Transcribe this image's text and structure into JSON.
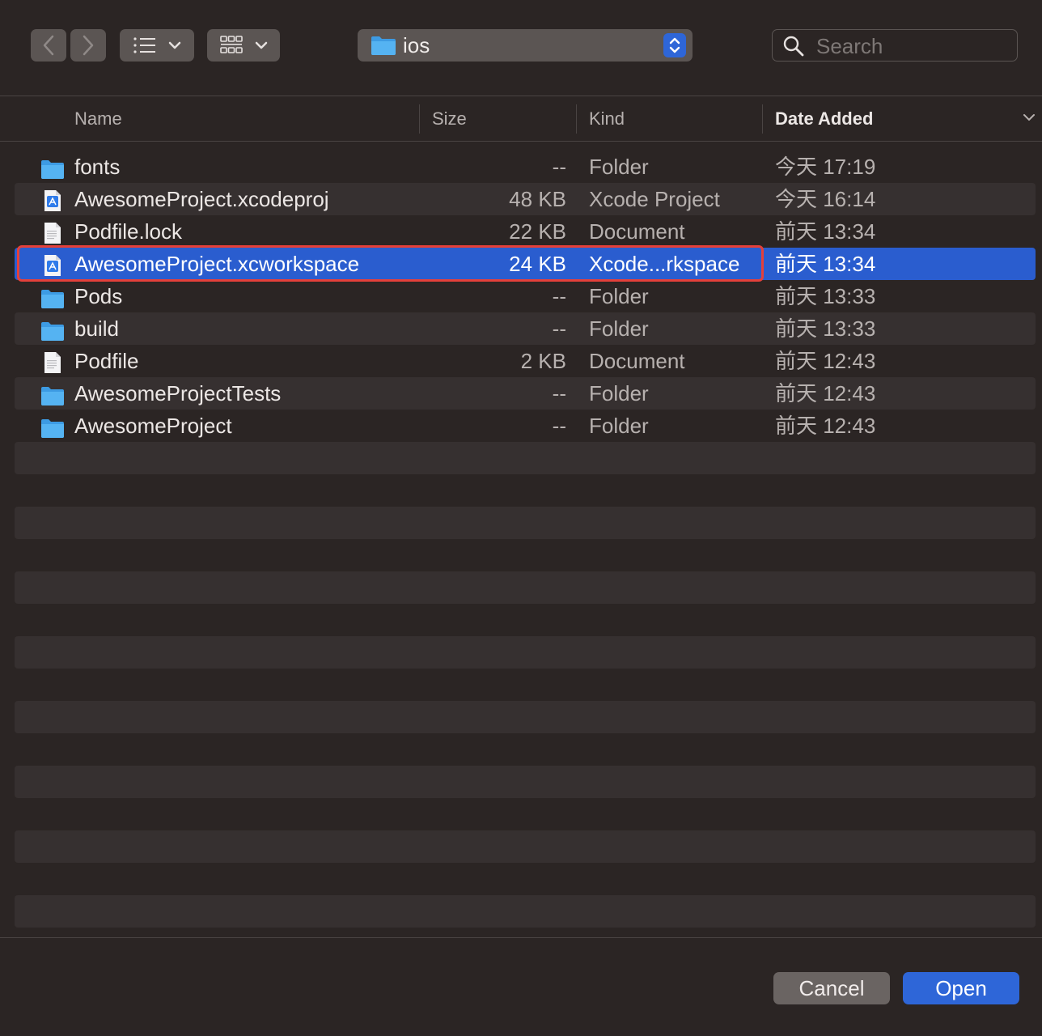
{
  "toolbar": {
    "back_icon": "chevron-left-icon",
    "forward_icon": "chevron-right-icon",
    "list_view_icon": "list-view-icon",
    "grid_view_icon": "grid-view-icon",
    "path_label": "ios",
    "search_placeholder": "Search"
  },
  "columns": {
    "name": "Name",
    "size": "Size",
    "kind": "Kind",
    "date": "Date Added"
  },
  "files": [
    {
      "name": "fonts",
      "size": "--",
      "kind": "Folder",
      "date": "今天 17:19",
      "icon": "folder"
    },
    {
      "name": "AwesomeProject.xcodeproj",
      "size": "48 KB",
      "kind": "Xcode Project",
      "date": "今天 16:14",
      "icon": "xcode"
    },
    {
      "name": "Podfile.lock",
      "size": "22 KB",
      "kind": "Document",
      "date": "前天 13:34",
      "icon": "document"
    },
    {
      "name": "AwesomeProject.xcworkspace",
      "size": "24 KB",
      "kind": "Xcode...rkspace",
      "date": "前天 13:34",
      "icon": "xcode",
      "selected": true
    },
    {
      "name": "Pods",
      "size": "--",
      "kind": "Folder",
      "date": "前天 13:33",
      "icon": "folder"
    },
    {
      "name": "build",
      "size": "--",
      "kind": "Folder",
      "date": "前天 13:33",
      "icon": "folder"
    },
    {
      "name": "Podfile",
      "size": "2 KB",
      "kind": "Document",
      "date": "前天 12:43",
      "icon": "document"
    },
    {
      "name": "AwesomeProjectTests",
      "size": "--",
      "kind": "Folder",
      "date": "前天 12:43",
      "icon": "folder"
    },
    {
      "name": "AwesomeProject",
      "size": "--",
      "kind": "Folder",
      "date": "前天 12:43",
      "icon": "folder"
    }
  ],
  "footer": {
    "cancel_label": "Cancel",
    "open_label": "Open"
  },
  "colors": {
    "background": "#2b2524",
    "selection": "#2a5dcf",
    "accent": "#2e66d8",
    "highlight_border": "#e4403a"
  }
}
